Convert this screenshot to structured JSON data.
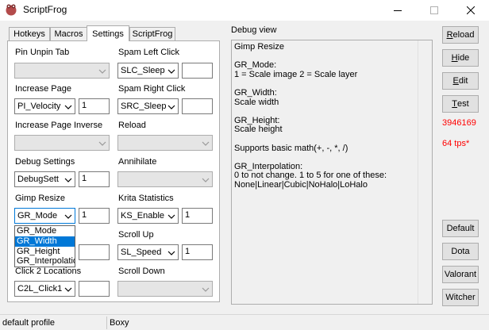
{
  "window": {
    "title": "ScriptFrog"
  },
  "tabs": [
    {
      "label": "Hotkeys"
    },
    {
      "label": "Macros"
    },
    {
      "label": "Settings"
    },
    {
      "label": "ScriptFrog"
    }
  ],
  "settings": {
    "pin_unpin_tab": {
      "label": "Pin Unpin Tab",
      "value": ""
    },
    "spam_left_click": {
      "label": "Spam Left Click",
      "value": "SLC_Sleep",
      "amount": ""
    },
    "increase_page": {
      "label": "Increase Page",
      "value": "PI_Velocity",
      "amount": "1"
    },
    "spam_right_click": {
      "label": "Spam Right Click",
      "value": "SRC_Sleep",
      "amount": ""
    },
    "increase_page_inverse": {
      "label": "Increase Page Inverse",
      "value": ""
    },
    "reload": {
      "label": "Reload",
      "value": ""
    },
    "debug_settings": {
      "label": "Debug Settings",
      "value": "DebugSett",
      "amount": "1"
    },
    "annihilate": {
      "label": "Annihilate",
      "value": ""
    },
    "gimp_resize": {
      "label": "Gimp Resize",
      "value": "GR_Mode",
      "amount": "1",
      "options": [
        "GR_Mode",
        "GR_Width",
        "GR_Height",
        "GR_Interpolation"
      ],
      "highlighted": "GR_Width"
    },
    "krita_statistics": {
      "label": "Krita Statistics",
      "value": "KS_Enable",
      "amount": "1"
    },
    "scroll_up": {
      "label": "Scroll Up",
      "value": "SL_Speed",
      "amount": "1"
    },
    "click_2_locations": {
      "label": "Click 2 Locations",
      "value": "C2L_Click1",
      "amount": ""
    },
    "scroll_down": {
      "label": "Scroll Down",
      "value": ""
    }
  },
  "debug": {
    "heading": "Debug view",
    "text": "Gimp Resize\n\nGR_Mode:\n1 = Scale image 2 = Scale layer\n\nGR_Width:\nScale width\n\nGR_Height:\nScale height\n\nSupports basic math(+, -, *, /)\n\nGR_Interpolation:\n0 to not change. 1 to 5 for one of these:\nNone|Linear|Cubic|NoHalo|LoHalo"
  },
  "buttons": {
    "reload": {
      "label": "Reload",
      "accel": "R"
    },
    "hide": {
      "label": "Hide",
      "accel": "H"
    },
    "edit": {
      "label": "Edit",
      "accel": "E"
    },
    "test": {
      "label": "Test",
      "accel": "T"
    },
    "default": "Default",
    "dota": "Dota",
    "valorant": "Valorant",
    "witcher": "Witcher"
  },
  "stats": {
    "counter": "3946169",
    "tps": "64 tps*"
  },
  "statusbar": {
    "profile": "default profile",
    "right": "Boxy"
  },
  "icons": {
    "app": "frog-icon",
    "minimize": "minimize-icon",
    "maximize": "maximize-icon",
    "close": "close-icon",
    "dropdown": "chevron-down-icon"
  },
  "colors": {
    "accent": "#0078d7",
    "stat_red": "#ff0000"
  }
}
